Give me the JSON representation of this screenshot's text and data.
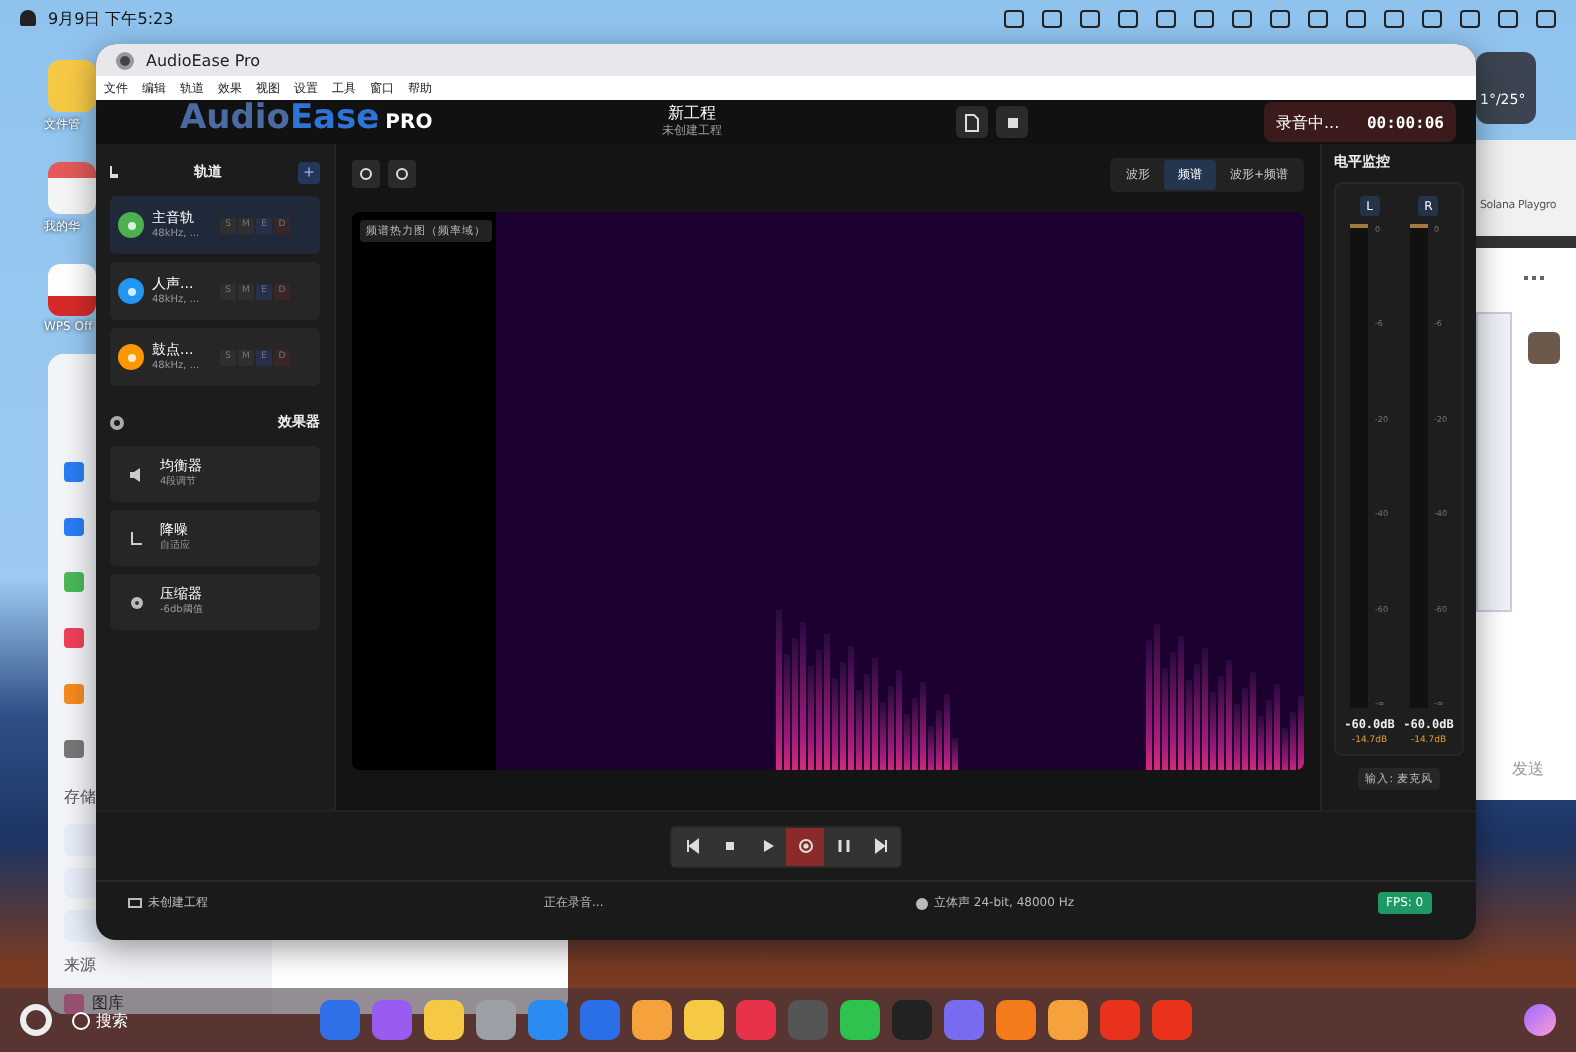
{
  "system_bar": {
    "date_time": "9月9日 下午5:23"
  },
  "desktop_icons": [
    {
      "label": "文件管",
      "kind": "folder"
    },
    {
      "label": "我的华",
      "kind": "box"
    },
    {
      "label": "WPS Off",
      "kind": "wps"
    }
  ],
  "weather_widget": {
    "text": "1°/25°"
  },
  "file_window": {
    "sections": [
      {
        "label": "存储"
      },
      {
        "label": "来源"
      }
    ],
    "items": [
      {
        "label": "图库"
      }
    ]
  },
  "chat_window": {
    "tab_title": "Solana Playgro",
    "send_button": "发送"
  },
  "app": {
    "title": "AudioEase Pro",
    "menu": [
      "文件",
      "编辑",
      "轨道",
      "效果",
      "视图",
      "设置",
      "工具",
      "窗口",
      "帮助"
    ],
    "logo": {
      "name_part_1": "Audio",
      "name_part_2": "Ease",
      "badge": "PRO"
    },
    "project": {
      "title": "新工程",
      "subtitle": "未创建工程"
    },
    "recording": {
      "label": "录音中...",
      "time": "00:00:06"
    },
    "tracks_panel": {
      "title": "轨道",
      "add_button": "+",
      "tracks": [
        {
          "name": "主音轨",
          "info": "48kHz, ...",
          "color": "#4caf50",
          "selected": true,
          "buttons": [
            "S",
            "M",
            "E",
            "D"
          ]
        },
        {
          "name": "人声...",
          "info": "48kHz, ...",
          "color": "#2196f3",
          "selected": false,
          "buttons": [
            "S",
            "M",
            "E",
            "D"
          ]
        },
        {
          "name": "鼓点...",
          "info": "48kHz, ...",
          "color": "#ff9800",
          "selected": false,
          "buttons": [
            "S",
            "M",
            "E",
            "D"
          ]
        }
      ]
    },
    "effects_panel": {
      "title": "效果器",
      "effects": [
        {
          "name": "均衡器",
          "detail": "4段调节",
          "kind": "speaker"
        },
        {
          "name": "降噪",
          "detail": "自适应",
          "kind": "hook"
        },
        {
          "name": "压缩器",
          "detail": "-6db阈值",
          "kind": "disc"
        }
      ]
    },
    "view_modes": [
      {
        "label": "波形",
        "selected": false
      },
      {
        "label": "频谱",
        "selected": true
      },
      {
        "label": "波形+频谱",
        "selected": false
      }
    ],
    "spectrogram": {
      "label": "频谱热力图（频率域）"
    },
    "level_monitor": {
      "title": "电平监控",
      "channels": [
        {
          "label": "L",
          "level": 0,
          "scale": [
            "0",
            "-6",
            "-20",
            "-40",
            "-60",
            "-∞"
          ],
          "reading": "-60.0dB",
          "peak": "-14.7dB"
        },
        {
          "label": "R",
          "level": 0,
          "scale": [
            "0",
            "-6",
            "-20",
            "-40",
            "-60",
            "-∞"
          ],
          "reading": "-60.0dB",
          "peak": "-14.7dB"
        }
      ],
      "input": "输入: 麦克风"
    },
    "transport": [
      {
        "kind": "rewind",
        "active": false
      },
      {
        "kind": "stop",
        "active": false
      },
      {
        "kind": "play",
        "active": false
      },
      {
        "kind": "record",
        "active": true
      },
      {
        "kind": "pause",
        "active": false
      },
      {
        "kind": "forward",
        "active": false
      }
    ],
    "status_bar": {
      "project": "未创建工程",
      "state": "正在录音...",
      "format": "立体声 24-bit, 48000 Hz",
      "fps": "FPS: 0"
    }
  },
  "dock": {
    "search": "搜索"
  }
}
